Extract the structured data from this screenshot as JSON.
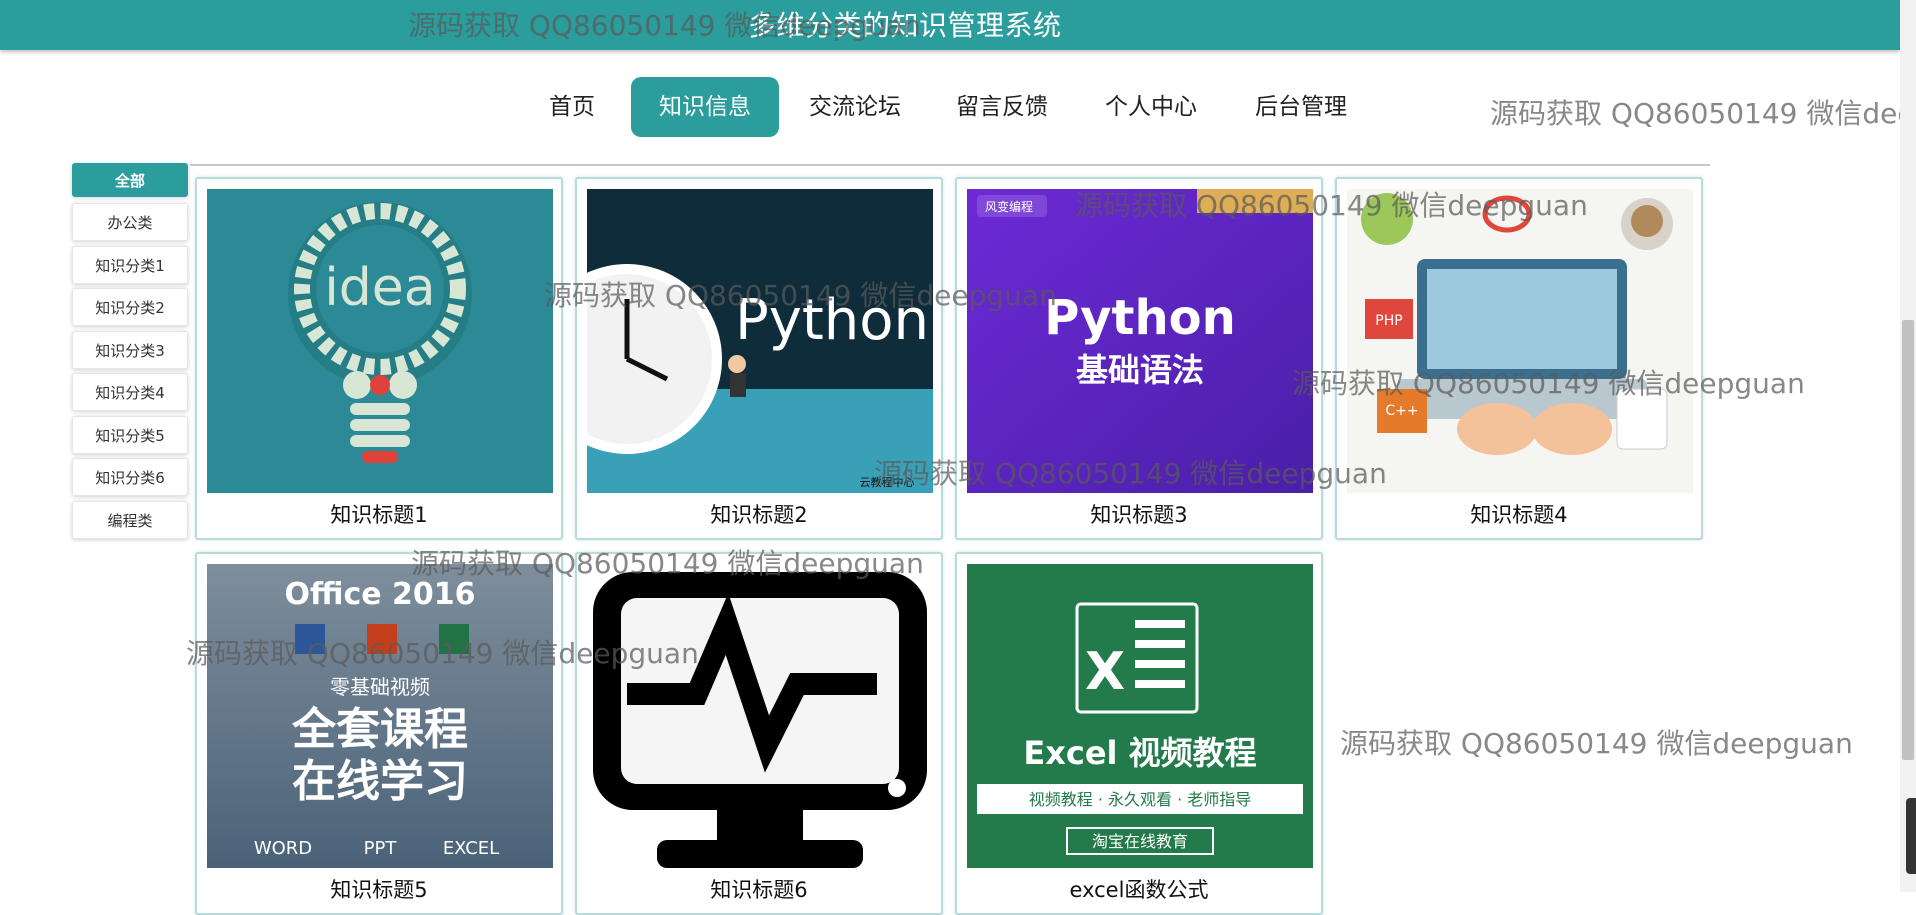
{
  "header": {
    "title": "多维分类的知识管理系统"
  },
  "nav": {
    "items": [
      {
        "label": "首页"
      },
      {
        "label": "知识信息",
        "active": true
      },
      {
        "label": "交流论坛"
      },
      {
        "label": "留言反馈"
      },
      {
        "label": "个人中心"
      },
      {
        "label": "后台管理"
      }
    ]
  },
  "sidebar": {
    "categories": [
      "全部",
      "办公类",
      "知识分类1",
      "知识分类2",
      "知识分类3",
      "知识分类4",
      "知识分类5",
      "知识分类6",
      "编程类"
    ],
    "active": "全部"
  },
  "cards": [
    {
      "title": "知识标题1",
      "image": "idea-lightbulb-gear"
    },
    {
      "title": "知识标题2",
      "image": "python-clock-runner",
      "image_text": "Python",
      "caption": "云教程中心"
    },
    {
      "title": "知识标题3",
      "image": "python-basic-syntax",
      "image_text": "Python",
      "image_subtext": "基础语法",
      "brand": "风变编程"
    },
    {
      "title": "知识标题4",
      "image": "laptop-desk-illustration",
      "labels": [
        "PHP",
        "C++"
      ]
    },
    {
      "title": "知识标题5",
      "image": "office-2016-course",
      "lines": [
        "Office 2016",
        "零基础视频",
        "全套课程",
        "在线学习",
        "WORD",
        "PPT",
        "EXCEL"
      ]
    },
    {
      "title": "知识标题6",
      "image": "monitor-pulse-icon"
    },
    {
      "title": "excel函数公式",
      "image": "excel-video-tutorial",
      "lines": [
        "Excel 视频教程",
        "视频教程 · 永久观看 · 老师指导",
        "淘宝在线教育"
      ]
    }
  ],
  "watermark": "源码获取 QQ86050149 微信deepguan",
  "colors": {
    "accent": "#2a9d9c",
    "card_border": "#b8dad9"
  }
}
